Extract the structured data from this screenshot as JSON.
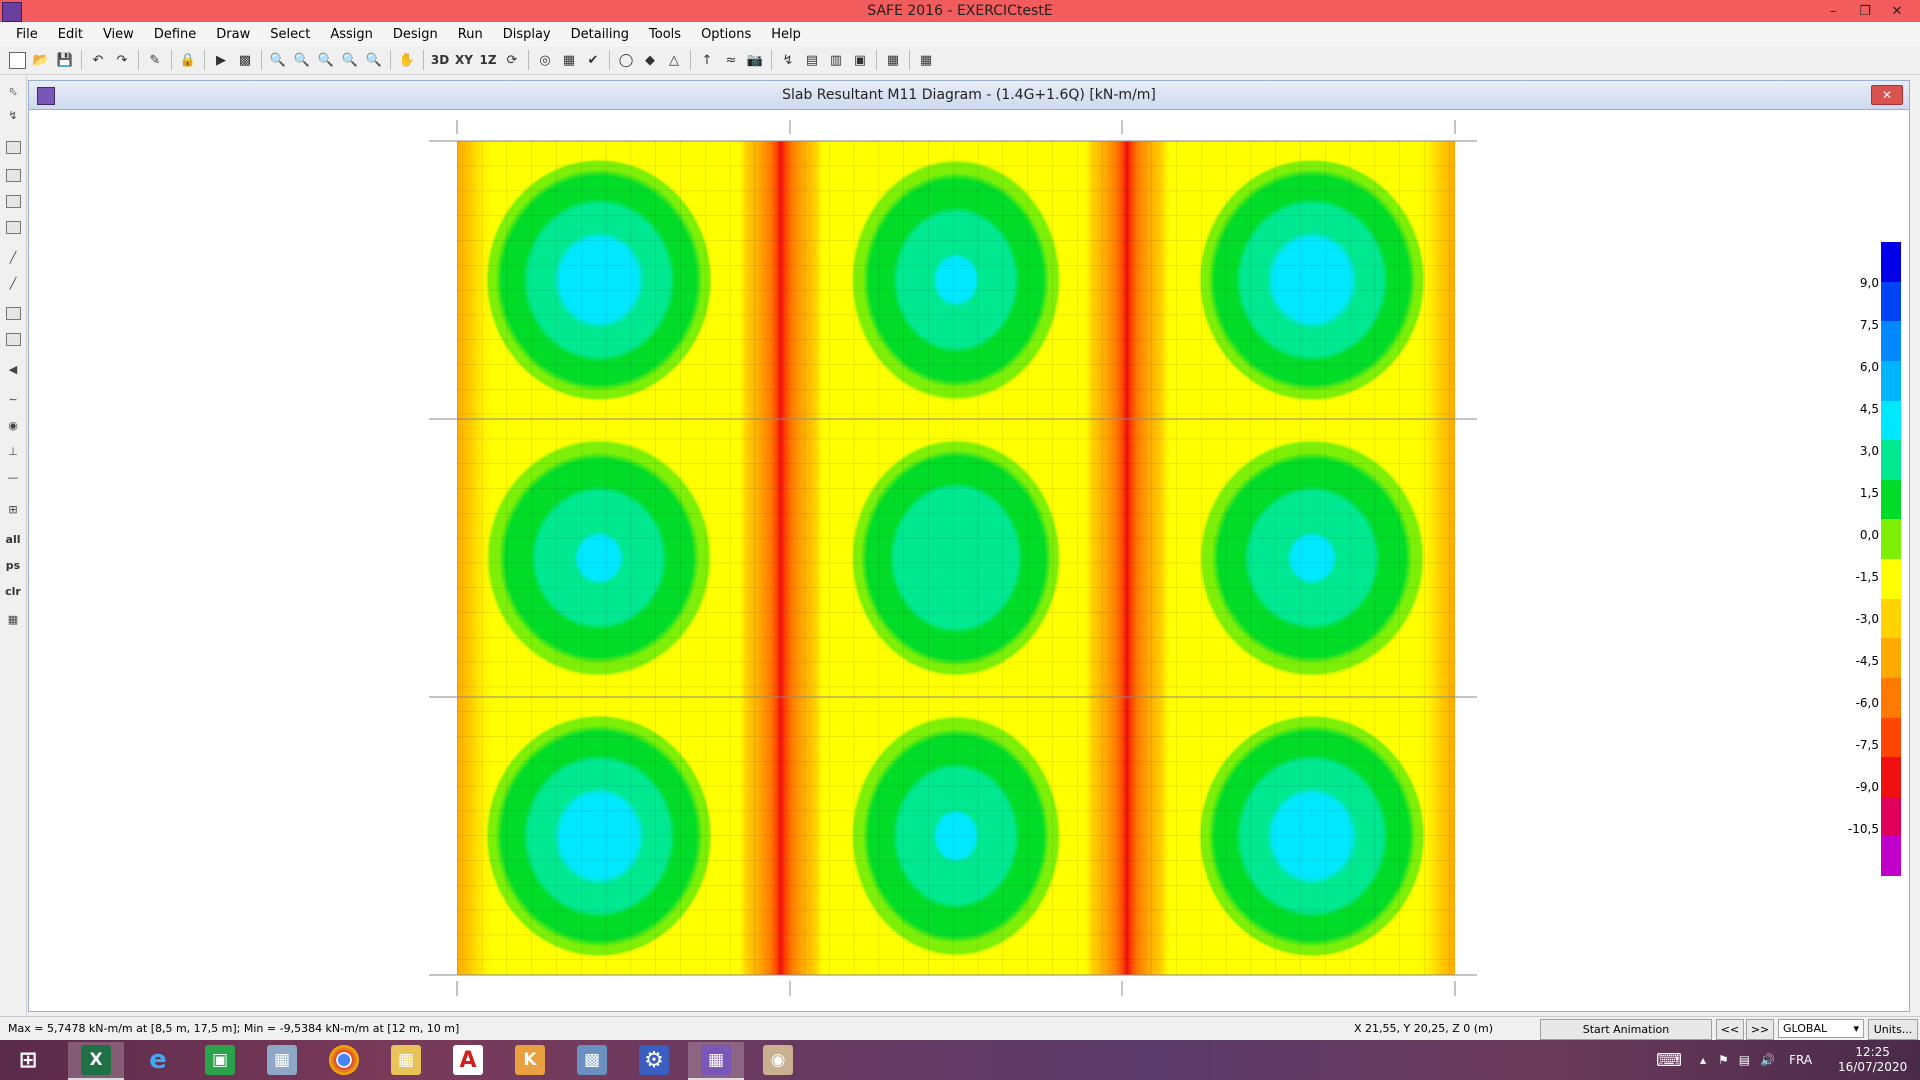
{
  "app": {
    "title": "SAFE 2016 - EXERCICtestE",
    "window_controls": [
      "–",
      "❐",
      "✕"
    ]
  },
  "menu": [
    "File",
    "Edit",
    "View",
    "Define",
    "Draw",
    "Select",
    "Assign",
    "Design",
    "Run",
    "Display",
    "Detailing",
    "Tools",
    "Options",
    "Help"
  ],
  "toolbar": {
    "view_3d": "3D",
    "view_xy": "XY",
    "view_1z": "1Z"
  },
  "left_toolbar": {
    "all": "all",
    "ps": "ps",
    "clr": "clr"
  },
  "diagram_window": {
    "title": "Slab Resultant M11 Diagram - (1.4G+1.6Q)  [kN-m/m]",
    "close": "✕"
  },
  "legend": {
    "labels": [
      "9,0",
      "7,5",
      "6,0",
      "4,5",
      "3,0",
      "1,5",
      "0,0",
      "-1,5",
      "-3,0",
      "-4,5",
      "-6,0",
      "-7,5",
      "-9,0",
      "-10,5"
    ],
    "colors": [
      "#0000e8",
      "#0044f5",
      "#0088ff",
      "#00b4ff",
      "#00e8ff",
      "#00e890",
      "#00dc28",
      "#7ef008",
      "#ffff00",
      "#ffd200",
      "#ffaa00",
      "#ff7a00",
      "#ff4500",
      "#f01010",
      "#e0005a",
      "#c000c8"
    ]
  },
  "status": {
    "maxmin": "Max = 5,7478 kN-m/m at [8,5 m, 17,5 m];  Min = -9,5384 kN-m/m at [12 m, 10 m]",
    "coords": "X 21,55,  Y 20,25,  Z 0  (m)",
    "start_animation": "Start Animation",
    "prev": "<<",
    "next": ">>",
    "coord_system": "GLOBAL",
    "units": "Units..."
  },
  "taskbar": {
    "language": "FRA",
    "time": "12:25",
    "date": "16/07/2020"
  }
}
